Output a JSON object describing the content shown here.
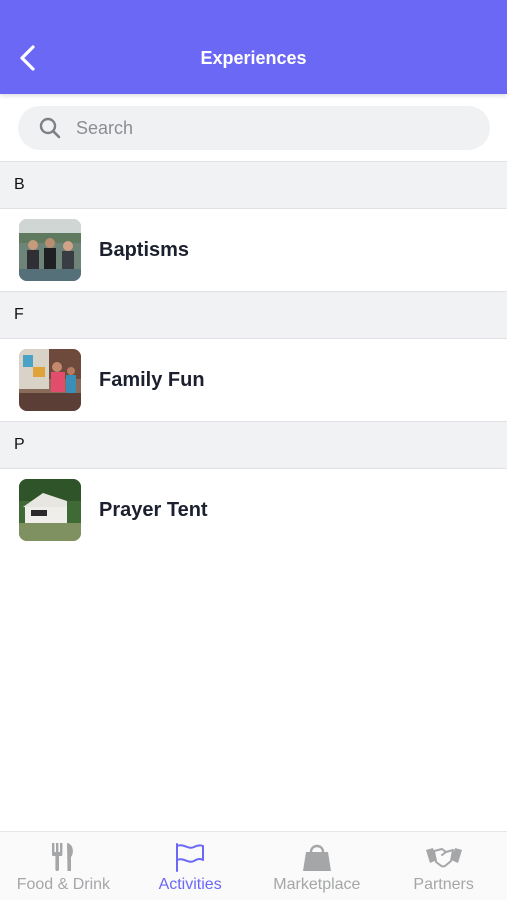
{
  "header": {
    "title": "Experiences",
    "back_icon": "chevron-left-icon",
    "color": "#6c68f6"
  },
  "search": {
    "placeholder": "Search",
    "value": "",
    "icon": "search-icon"
  },
  "sections": [
    {
      "letter": "B",
      "items": [
        {
          "label": "Baptisms",
          "thumb": "baptisms-photo"
        }
      ]
    },
    {
      "letter": "F",
      "items": [
        {
          "label": "Family Fun",
          "thumb": "family-fun-photo"
        }
      ]
    },
    {
      "letter": "P",
      "items": [
        {
          "label": "Prayer Tent",
          "thumb": "prayer-tent-photo"
        }
      ]
    }
  ],
  "tabs": [
    {
      "label": "Food & Drink",
      "icon": "fork-knife-icon",
      "active": false
    },
    {
      "label": "Activities",
      "icon": "flag-icon",
      "active": true
    },
    {
      "label": "Marketplace",
      "icon": "shopping-bag-icon",
      "active": false
    },
    {
      "label": "Partners",
      "icon": "handshake-icon",
      "active": false
    }
  ],
  "colors": {
    "accent": "#6c68f6",
    "inactive_tab": "#a5a6a8",
    "section_bg": "#f1f2f4"
  }
}
